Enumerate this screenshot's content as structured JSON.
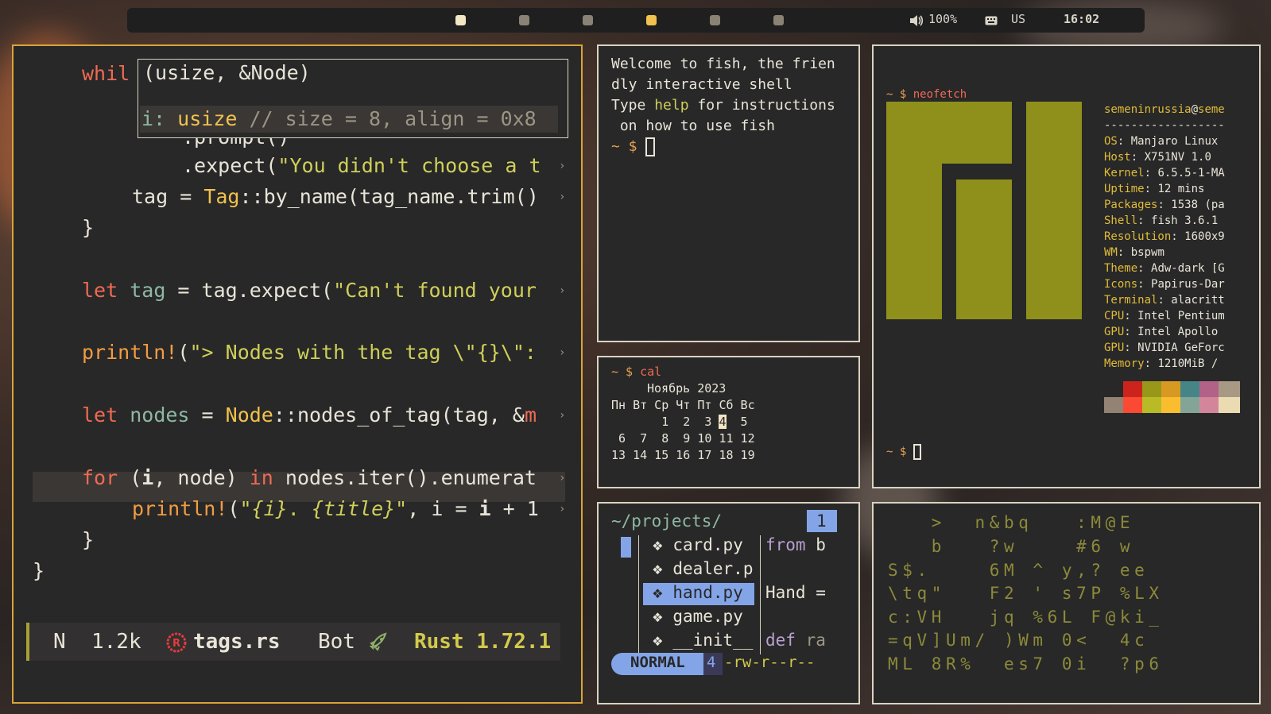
{
  "topbar": {
    "workspace_colors": [
      "#f2e6c5",
      "#8a8275",
      "#8a8275",
      "#f2c14e",
      "#8a8275",
      "#8a8275"
    ],
    "volume": "100%",
    "keyboard_layout": "US",
    "clock": "16:02"
  },
  "editor": {
    "popup": {
      "signature": "(usize, &Node)",
      "field_name": "i:",
      "field_type": "usize",
      "field_comment": "// size = 8, align = 0x8"
    },
    "code": {
      "l1_kw": "whil",
      "l2": ".prompt()",
      "l3_a": ".expect(",
      "l3_str": "\"You didn't choose a t",
      "l4_a": "tag = ",
      "l4_ty": "Tag",
      "l4_b": "::by_name(tag_name.trim()",
      "l5": "}",
      "l6_kw": "let",
      "l6_var": "tag",
      "l6_a": " = tag.expect(",
      "l6_str": "\"Can't found your",
      "l7_fn": "println!",
      "l7_a": "(",
      "l7_str": "\"> Nodes with the tag \\\"{}\\\":",
      "l8_kw": "let",
      "l8_var": "nodes",
      "l8_a": " = ",
      "l8_ty": "Node",
      "l8_b": "::nodes_of_tag(tag, &",
      "l8_c": "m",
      "l9_kw": "for",
      "l9_a": " (",
      "l9_i": "i",
      "l9_b": ", node) ",
      "l9_kw2": "in",
      "l9_c": " nodes.iter().enumerat",
      "l10_fn": "println!",
      "l10_a": "(",
      "l10_str1": "\"",
      "l10_ph1": "{i}",
      "l10_str2": ". ",
      "l10_ph2": "{title}",
      "l10_str3": "\"",
      "l10_b": ", i = ",
      "l10_i": "i",
      "l10_c": " + 1",
      "l11": "}",
      "l12": "}"
    },
    "statusline": {
      "mode": "N",
      "size": "1.2k",
      "filename": "tags.rs",
      "position": "Bot",
      "language": "Rust 1.72.1"
    }
  },
  "fish": {
    "lines": [
      "Welcome to fish, the frien",
      "dly interactive shell"
    ],
    "type_pre": "Type ",
    "help_word": "help",
    "type_post": " for instructions",
    "line4": " on how to use fish",
    "prompt": "~ $ "
  },
  "cal": {
    "prompt": "~ $ ",
    "command": "cal",
    "month": "Ноябрь 2023",
    "weekdays": "Пн Вт Ср Чт Пт Сб Вс",
    "week1_pre": "       1  2  3 ",
    "today": "4",
    "week1_post": "  5",
    "week2": " 6  7  8  9 10 11 12",
    "week3": "13 14 15 16 17 18 19"
  },
  "lf": {
    "path": "~/projects/",
    "count": "1",
    "files": [
      "card.py",
      "dealer.p",
      "hand.py",
      "game.py",
      "__init__"
    ],
    "preview": [
      "from b",
      "",
      "Hand =",
      "",
      "def ra"
    ],
    "mode": "NORMAL",
    "perm_num": "4",
    "perms": "-rw-r--r--"
  },
  "neofetch": {
    "prompt": "~ $ ",
    "command": "neofetch",
    "user": "semeninrussia",
    "at": "@",
    "host": "seme",
    "separator": "------------------",
    "info": [
      {
        "k": "OS",
        "v": " Manjaro Linux"
      },
      {
        "k": "Host",
        "v": " X751NV 1.0"
      },
      {
        "k": "Kernel",
        "v": " 6.5.5-1-MA"
      },
      {
        "k": "Uptime",
        "v": " 12 mins"
      },
      {
        "k": "Packages",
        "v": " 1538 (pa"
      },
      {
        "k": "Shell",
        "v": " fish 3.6.1"
      },
      {
        "k": "Resolution",
        "v": " 1600x9"
      },
      {
        "k": "WM",
        "v": " bspwm"
      },
      {
        "k": "Theme",
        "v": " Adw-dark [G"
      },
      {
        "k": "Icons",
        "v": " Papirus-Dar"
      },
      {
        "k": "Terminal",
        "v": " alacritt"
      },
      {
        "k": "CPU",
        "v": " Intel Pentium"
      },
      {
        "k": "GPU",
        "v": " Intel Apollo"
      },
      {
        "k": "GPU",
        "v": " NVIDIA GeForc"
      },
      {
        "k": "Memory",
        "v": " 1210MiB /"
      }
    ],
    "palette_top": [
      "#282828",
      "#cc241d",
      "#98971a",
      "#d79921",
      "#458588",
      "#b16286",
      "#a89984"
    ],
    "palette_bottom": [
      "#928374",
      "#fb4934",
      "#b8bb26",
      "#fabd2f",
      "#83a598",
      "#d3869b",
      "#ebdbb2"
    ],
    "prompt2": "~ $ "
  },
  "matrix": {
    "rows": [
      "   >  n&bq   :M@E",
      "   b   ?w    #6 w",
      "S$.    6M ^ y,? ee",
      "\\tq\"   F2 ' s7P %LX",
      "c:VH   jq %6L F@ki_",
      "=qV]Um/ )Wm 0<  4c",
      "ML 8R%  es7 0i  ?p6"
    ]
  }
}
